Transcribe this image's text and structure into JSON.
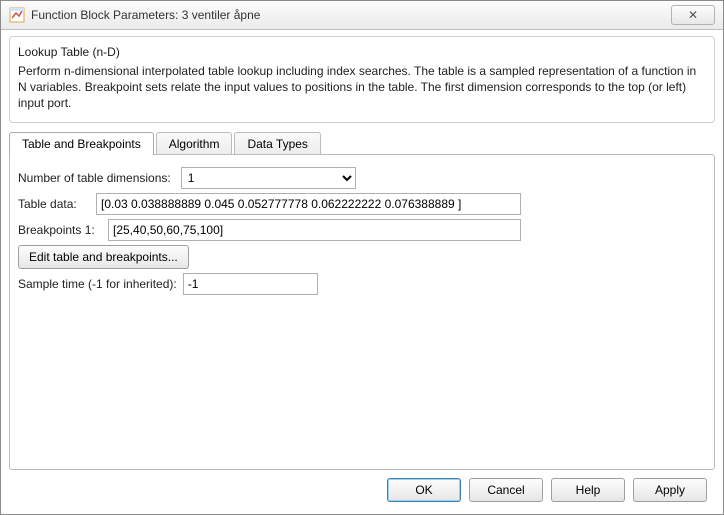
{
  "window": {
    "title": "Function Block Parameters: 3 ventiler åpne",
    "close_glyph": "✕"
  },
  "group": {
    "title": "Lookup Table (n-D)",
    "description": "Perform n-dimensional interpolated table lookup including index searches. The table is a sampled representation of a function in N variables. Breakpoint sets relate the input values to positions in the table. The first dimension corresponds to the top (or left) input port."
  },
  "tabs": {
    "items": [
      {
        "label": "Table and Breakpoints",
        "active": true
      },
      {
        "label": "Algorithm",
        "active": false
      },
      {
        "label": "Data Types",
        "active": false
      }
    ]
  },
  "fields": {
    "num_dims_label": "Number of table dimensions:",
    "num_dims_value": "1",
    "table_data_label": "Table data:",
    "table_data_value": "[0.03 0.038888889 0.045 0.052777778 0.062222222 0.076388889 ]",
    "bp1_label": "Breakpoints 1:",
    "bp1_value": "[25,40,50,60,75,100]",
    "edit_btn": "Edit table and breakpoints...",
    "sample_time_label": "Sample time (-1 for inherited):",
    "sample_time_value": "-1"
  },
  "buttons": {
    "ok": "OK",
    "cancel": "Cancel",
    "help": "Help",
    "apply": "Apply"
  },
  "colors": {
    "accent": "#3c7fb1"
  }
}
